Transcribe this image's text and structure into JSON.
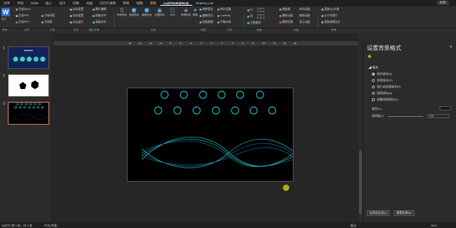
{
  "menu": {
    "tabs": [
      "文件",
      "开始",
      "iSlide",
      "插入",
      "设计",
      "切换",
      "动画",
      "幻灯片放映",
      "审阅",
      "视图",
      "帮助",
      "LvyhTools(0514)",
      "OneKey Lite"
    ],
    "active_tab": "LvyhTools(0514)",
    "share_label": "共享"
  },
  "ribbon": {
    "logo_label": "关于",
    "items": {
      "generate_word": "生成Word",
      "generate_ppt": "生成PPT",
      "generate_ppt2": "生成PPT",
      "font_spacing": "字体间距",
      "font_size": "字体大小",
      "char_spacing": "字体距",
      "auto_size": "自动设置",
      "auto_fit": "自动设置",
      "auto_run": "自动运行",
      "dropdown_a": "图片编辑",
      "dropdown_b": "网格对齐",
      "dropdown_c": "高级对齐",
      "big_1": "流动形状",
      "big_2": "渐变形状",
      "big_3": "缩放形状",
      "big_4": "位置形状",
      "big_5": "SVG",
      "big_6": "滤镜形状",
      "big_7": "转换",
      "ordered_x": "线转箭头",
      "ordered_y": "编辑顶点",
      "ordered_z": "批量替换",
      "calc_1": "布尔运算",
      "calc_2": "LowPoly",
      "calc_3": "平衡布局",
      "row_label": "行",
      "col_label": "列",
      "row_val": "2",
      "col_val": "2",
      "split_label": "分割图形",
      "anim_1": "超链接",
      "anim_2": "删除动画",
      "anim_3": "删除切换",
      "anim_4": "补间动画",
      "anim_5": "曲线动画",
      "anim_6": "显示动画",
      "tool_1": "获取QQ头像",
      "tool_2": "公众号图片",
      "tool_3": "获取表情包头"
    },
    "groups": [
      "帮助",
      "文件",
      "字体",
      "文本",
      "图片布局",
      "形状",
      "图层",
      "计算",
      "表格",
      "动画",
      "其他"
    ]
  },
  "ruler": [
    "16",
    "14",
    "12",
    "10",
    "8",
    "6",
    "4",
    "2",
    "0",
    "2",
    "4",
    "6",
    "8",
    "10",
    "12",
    "14",
    "16"
  ],
  "thumbnails": [
    {
      "number": "1"
    },
    {
      "number": "2"
    },
    {
      "number": "3"
    }
  ],
  "format_pane": {
    "title": "设置背景格式",
    "section_fill": "填充",
    "options": [
      "纯色填充(S)",
      "渐变填充(G)",
      "图片或纹理填充(P)",
      "图案填充(A)"
    ],
    "selected_option": "纯色填充(S)",
    "hide_bg": "隐藏背景图形(H)",
    "color_label": "颜色(C)",
    "transparency_label": "透明度(T)",
    "transparency_value": "0%",
    "apply_all": "应用到全部(L)",
    "reset_bg": "重置背景(B)"
  },
  "status": {
    "slide_info": "幻灯片 第 3 张，共 3 张",
    "language": "中文(中国)",
    "notes": "备注",
    "zoom": "50%"
  },
  "colors": {
    "circle_stroke": "#24a6b8",
    "wave_a": "#2ad6e0",
    "wave_b": "#1a7fb0",
    "selection_border": "#e07b5c"
  }
}
